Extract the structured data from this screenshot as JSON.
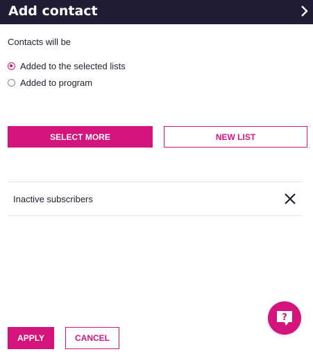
{
  "header": {
    "title": "Add contact",
    "close_icon": "chevron-right-icon"
  },
  "form": {
    "subtitle": "Contacts will be",
    "options": [
      {
        "label": "Added to the selected lists",
        "selected": true
      },
      {
        "label": "Added to program",
        "selected": false
      }
    ]
  },
  "actions": {
    "select_more_label": "SELECT MORE",
    "new_list_label": "NEW LIST"
  },
  "selected_lists": [
    {
      "label": "Inactive subscribers",
      "remove_icon": "close-icon"
    }
  ],
  "footer": {
    "apply_label": "APPLY",
    "cancel_label": "CANCEL"
  },
  "help": {
    "icon": "help-chat-icon",
    "glyph": "?"
  },
  "colors": {
    "accent": "#d4147d",
    "header_bg": "#221c35"
  }
}
